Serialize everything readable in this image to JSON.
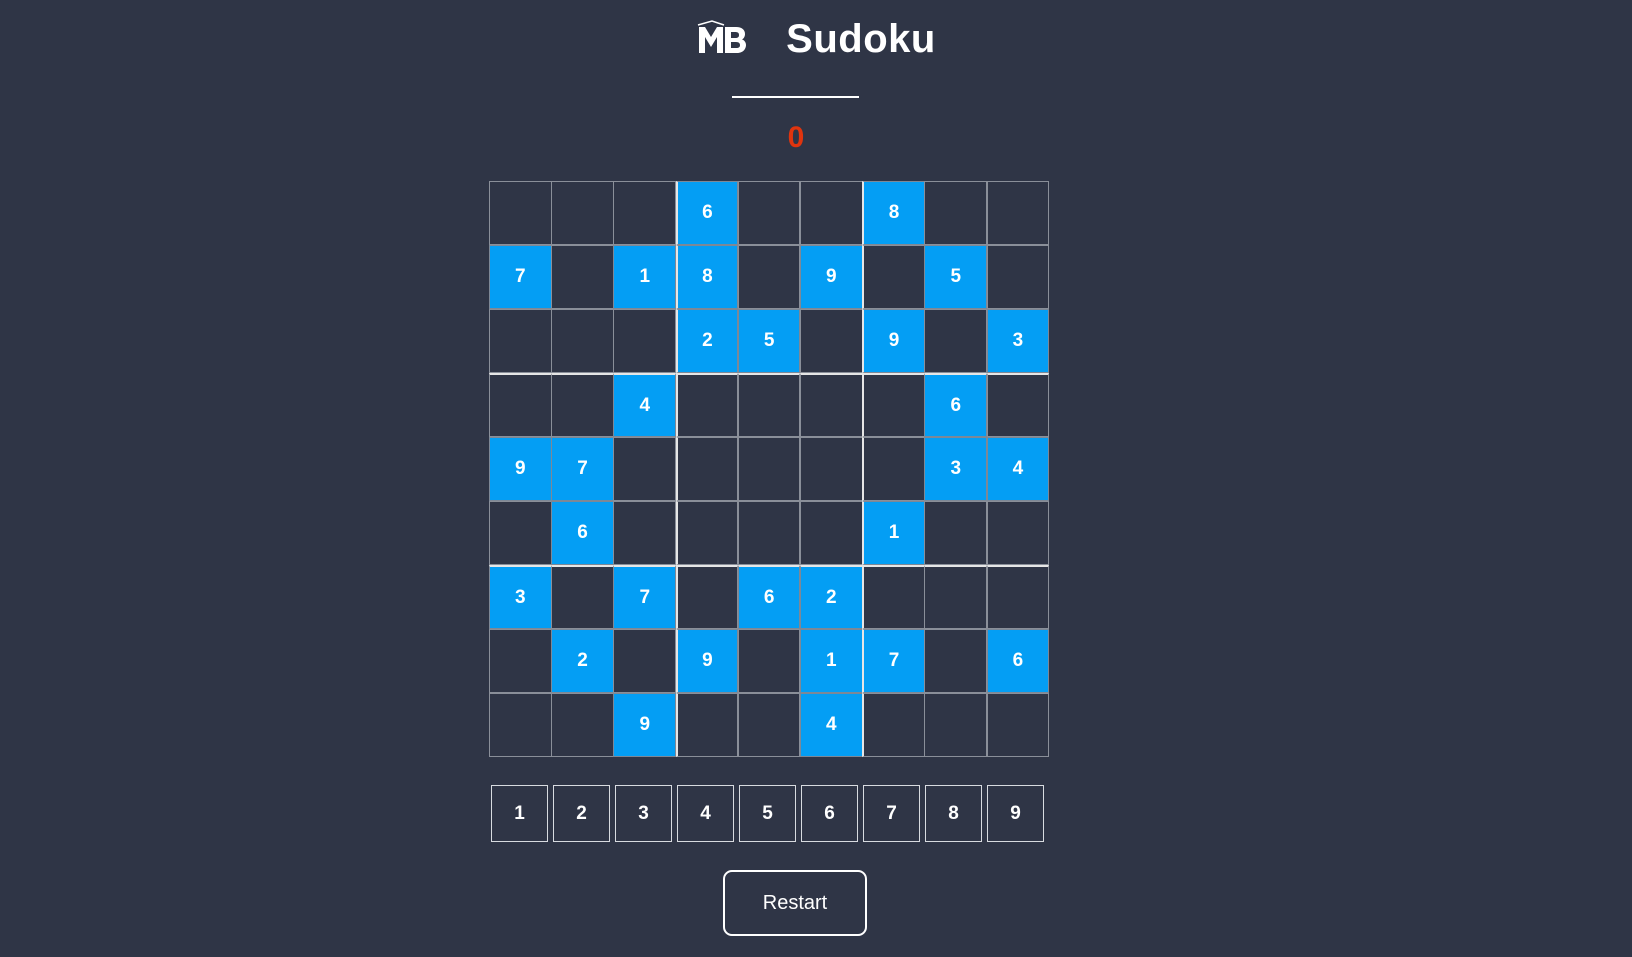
{
  "header": {
    "logo_text": "MB",
    "logo_icon": "mb-logo-icon",
    "title": "Sudoku"
  },
  "score": "0",
  "colors": {
    "background": "#2f3546",
    "given_cell": "#049ef4",
    "score": "#e0340e",
    "text": "#ffffff"
  },
  "board": [
    [
      "",
      "",
      "",
      "6",
      "",
      "",
      "8",
      "",
      ""
    ],
    [
      "7",
      "",
      "1",
      "8",
      "",
      "9",
      "",
      "5",
      ""
    ],
    [
      "",
      "",
      "",
      "2",
      "5",
      "",
      "9",
      "",
      "3"
    ],
    [
      "",
      "",
      "4",
      "",
      "",
      "",
      "",
      "6",
      ""
    ],
    [
      "9",
      "7",
      "",
      "",
      "",
      "",
      "",
      "3",
      "4"
    ],
    [
      "",
      "6",
      "",
      "",
      "",
      "",
      "1",
      "",
      ""
    ],
    [
      "3",
      "",
      "7",
      "",
      "6",
      "2",
      "",
      "",
      ""
    ],
    [
      "",
      "2",
      "",
      "9",
      "",
      "1",
      "7",
      "",
      "6"
    ],
    [
      "",
      "",
      "9",
      "",
      "",
      "4",
      "",
      "",
      ""
    ]
  ],
  "numpad": [
    "1",
    "2",
    "3",
    "4",
    "5",
    "6",
    "7",
    "8",
    "9"
  ],
  "restart_label": "Restart"
}
